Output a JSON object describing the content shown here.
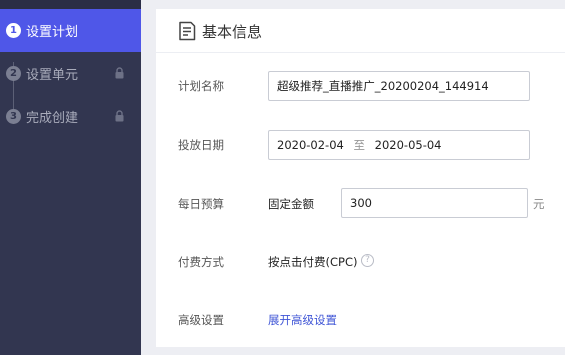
{
  "steps": [
    {
      "number": "1",
      "label": "设置计划",
      "state": "active"
    },
    {
      "number": "2",
      "label": "设置单元",
      "state": "locked"
    },
    {
      "number": "3",
      "label": "完成创建",
      "state": "locked"
    }
  ],
  "section": {
    "title": "基本信息"
  },
  "form": {
    "plan_name": {
      "label": "计划名称",
      "value": "超级推荐_直播推广_20200204_144914"
    },
    "schedule": {
      "label": "投放日期",
      "start": "2020-02-04",
      "separator": "至",
      "end": "2020-05-04"
    },
    "budget": {
      "label": "每日预算",
      "type": "固定金额",
      "amount": "300",
      "unit": "元"
    },
    "billing": {
      "label": "付费方式",
      "value": "按点击付费(CPC)",
      "help": "?"
    },
    "advanced": {
      "label": "高级设置",
      "link": "展开高级设置"
    }
  },
  "colors": {
    "sidebar_bg": "#323650",
    "active_step": "#4f57e8",
    "link": "#3f55d6"
  },
  "icons": {
    "lock": "lock-icon",
    "document": "document-icon",
    "help": "help-icon"
  }
}
